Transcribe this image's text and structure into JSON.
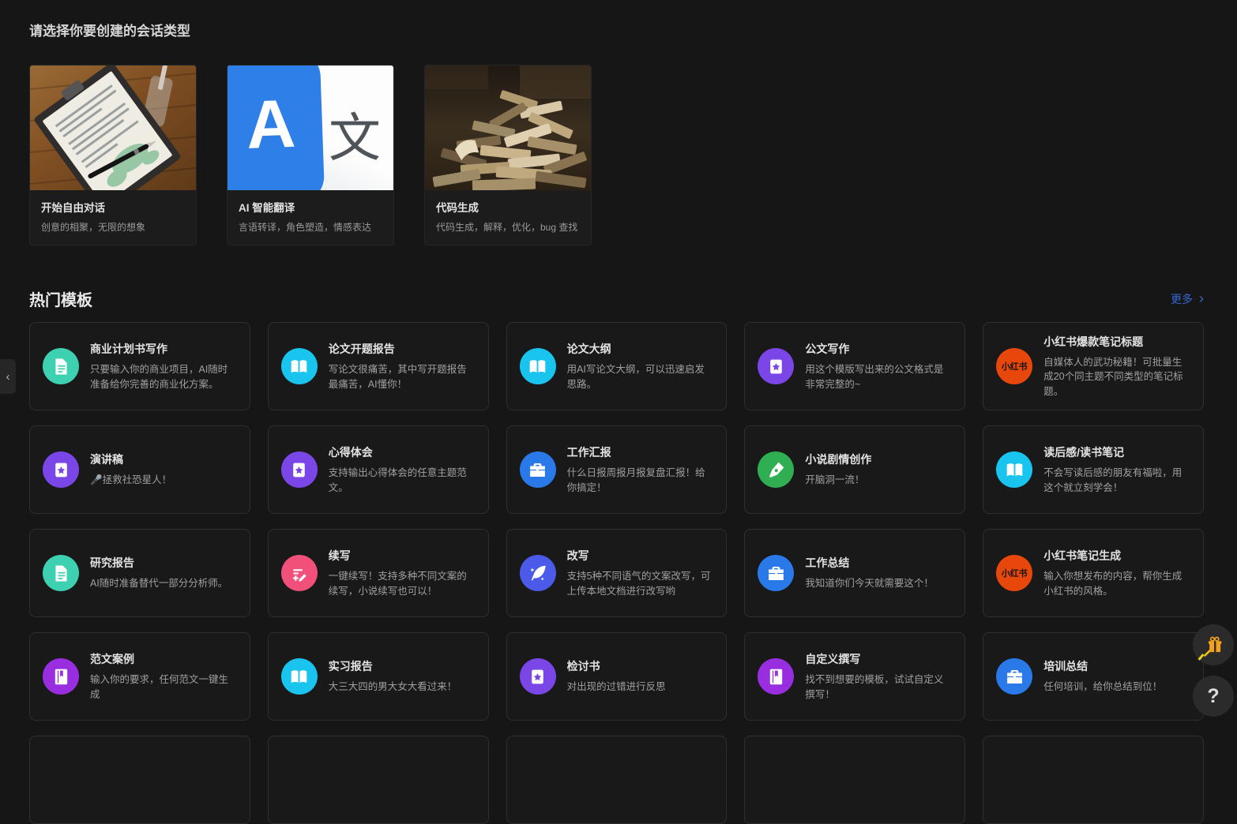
{
  "session_section": {
    "title": "请选择你要创建的会话类型",
    "cards": [
      {
        "title": "开始自由对话",
        "desc": "创意的相聚，无限的想象",
        "image": "paper-and-pen-photo"
      },
      {
        "title": "AI 智能翻译",
        "desc": "言语转译，角色塑造，情感表达",
        "image": "translate-app-icon",
        "badge_a": "A",
        "badge_wen": "文"
      },
      {
        "title": "代码生成",
        "desc": "代码生成，解释，优化，bug 查找",
        "image": "books-pile-photo"
      }
    ]
  },
  "templates_section": {
    "title": "热门模板",
    "more": {
      "label": "更多",
      "chevron": "›",
      "color": "#3568d4"
    },
    "items": [
      {
        "title": "商业计划书写作",
        "desc": "只要输入你的商业项目，AI随时准备给你完善的商业化方案。",
        "icon": "document",
        "icon_color": "#3ed1b1"
      },
      {
        "title": "论文开题报告",
        "desc": "写论文很痛苦，其中写开题报告最痛苦，AI懂你！",
        "icon": "open-book",
        "icon_color": "#19c5ee"
      },
      {
        "title": "论文大纲",
        "desc": "用AI写论文大纲，可以迅速启发思路。",
        "icon": "open-book",
        "icon_color": "#19c5ee"
      },
      {
        "title": "公文写作",
        "desc": "用这个模版写出来的公文格式是非常完整的~",
        "icon": "star-card",
        "icon_color": "#7b46e8"
      },
      {
        "title": "小红书爆款笔记标题",
        "desc": "自媒体人的武功秘籍！可批量生成20个同主题不同类型的笔记标题。",
        "icon": "xiaohongshu",
        "icon_color": "#e8470b",
        "icon_text": "小红书"
      },
      {
        "title": "演讲稿",
        "desc": "🎤拯救社恐星人！",
        "icon": "star-card",
        "icon_color": "#7b46e8"
      },
      {
        "title": "心得体会",
        "desc": "支持输出心得体会的任意主题范文。",
        "icon": "star-card",
        "icon_color": "#7b46e8"
      },
      {
        "title": "工作汇报",
        "desc": "什么日报周报月报复盘汇报！给你搞定！",
        "icon": "briefcase",
        "icon_color": "#2979e8"
      },
      {
        "title": "小说剧情创作",
        "desc": "开脑洞一流！",
        "icon": "pen-nib",
        "icon_color": "#2fae52"
      },
      {
        "title": "读后感/读书笔记",
        "desc": "不会写读后感的朋友有福啦，用这个就立刻学会！",
        "icon": "open-book",
        "icon_color": "#19c5ee"
      },
      {
        "title": "研究报告",
        "desc": "AI随时准备替代一部分分析师。",
        "icon": "document",
        "icon_color": "#3ed1b1"
      },
      {
        "title": "续写",
        "desc": "一键续写！支持多种不同文案的续写，小说续写也可以！",
        "icon": "edit-lines",
        "icon_color": "#f0507a"
      },
      {
        "title": "改写",
        "desc": "支持5种不同语气的文案改写，可上传本地文档进行改写哟",
        "icon": "feather",
        "icon_color": "#4b5ae8"
      },
      {
        "title": "工作总结",
        "desc": "我知道你们今天就需要这个！",
        "icon": "briefcase",
        "icon_color": "#2979e8"
      },
      {
        "title": "小红书笔记生成",
        "desc": "输入你想发布的内容，帮你生成小红书的风格。",
        "icon": "xiaohongshu",
        "icon_color": "#e8470b",
        "icon_text": "小红书"
      },
      {
        "title": "范文案例",
        "desc": "输入你的要求，任何范文一键生成",
        "icon": "notebook",
        "icon_color": "#992ee0"
      },
      {
        "title": "实习报告",
        "desc": "大三大四的男大女大看过来！",
        "icon": "open-book",
        "icon_color": "#19c5ee"
      },
      {
        "title": "检讨书",
        "desc": "对出现的过错进行反思",
        "icon": "star-card",
        "icon_color": "#7b46e8"
      },
      {
        "title": "自定义撰写",
        "desc": "找不到想要的模板，试试自定义撰写！",
        "icon": "notebook",
        "icon_color": "#992ee0"
      },
      {
        "title": "培训总结",
        "desc": "任何培训，给你总结到位！",
        "icon": "briefcase",
        "icon_color": "#2979e8"
      }
    ]
  },
  "floating": {
    "collapse_chevron": "‹",
    "help_label": "?",
    "gift_icon": "gift",
    "gift_color": "#f2a11c"
  }
}
